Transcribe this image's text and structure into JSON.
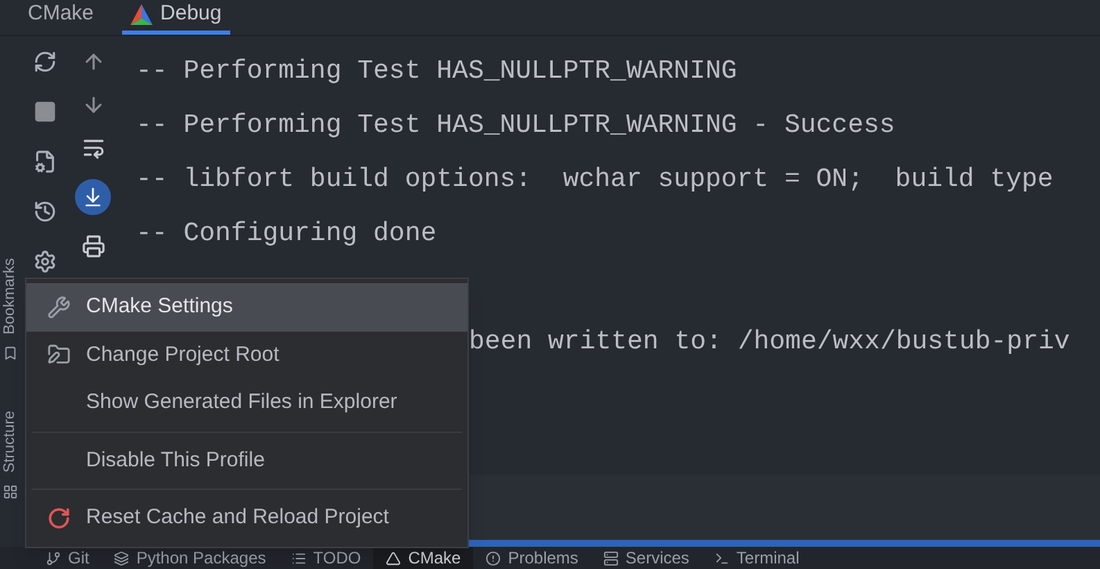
{
  "tool_window": {
    "tabs": [
      {
        "label": "CMake",
        "selected": false
      },
      {
        "label": "Debug",
        "selected": true
      }
    ]
  },
  "toolbar": {
    "scroll_to_end_on": true
  },
  "console": {
    "lines": [
      {
        "kind": "full",
        "text": "-- Performing Test HAS_NULLPTR_WARNING"
      },
      {
        "kind": "full",
        "text": "-- Performing Test HAS_NULLPTR_WARNING - Success"
      },
      {
        "kind": "full",
        "text": "-- libfort build options:  wchar support = ON;  build type"
      },
      {
        "kind": "full",
        "text": "-- Configuring done"
      },
      {
        "kind": "covered"
      },
      {
        "kind": "covered",
        "text": "been written to: /home/wxx/bustub-priv"
      }
    ]
  },
  "side_labels": [
    "Bookmarks",
    "Structure"
  ],
  "context_menu": {
    "items": [
      {
        "kind": "item",
        "label": "CMake Settings",
        "selected": true
      },
      {
        "kind": "item",
        "label": "Change Project Root",
        "selected": false
      },
      {
        "kind": "item",
        "label": "Show Generated Files in Explorer",
        "selected": false
      },
      {
        "kind": "separator"
      },
      {
        "kind": "item",
        "label": "Disable This Profile",
        "selected": false
      },
      {
        "kind": "separator"
      },
      {
        "kind": "item",
        "label": "Reset Cache and Reload Project",
        "selected": false
      }
    ]
  },
  "bottom_tabs": [
    {
      "label": "Git",
      "selected": false
    },
    {
      "label": "Python Packages",
      "selected": false
    },
    {
      "label": "TODO",
      "selected": false
    },
    {
      "label": "CMake",
      "selected": true
    },
    {
      "label": "Problems",
      "selected": false
    },
    {
      "label": "Services",
      "selected": false
    },
    {
      "label": "Terminal",
      "selected": false
    }
  ]
}
